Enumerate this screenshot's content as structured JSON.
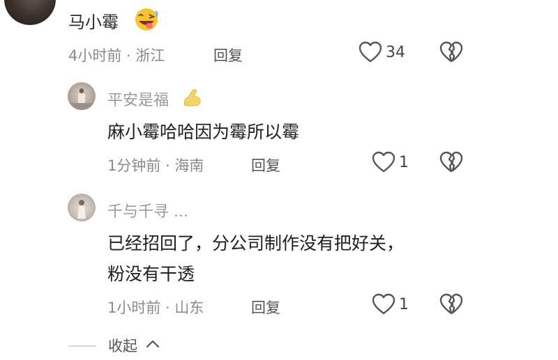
{
  "comment": {
    "author": "马小霉",
    "emoji": "laughing-tongue-emoji",
    "time_location": "4小时前 · 浙江",
    "reply_label": "回复",
    "likes": "34"
  },
  "replies": [
    {
      "author": "平安是福",
      "author_emoji": "flexed-biceps-emoji",
      "text_lines": [
        "麻小霉哈哈因为霉所以霉"
      ],
      "time_location": "1分钟前 · 海南",
      "reply_label": "回复",
      "likes": "1"
    },
    {
      "author": "千与千寻 ...",
      "text_lines": [
        "已经招回了，分公司制作没有把好关，",
        "粉没有干透"
      ],
      "time_location": "1小时前 · 山东",
      "reply_label": "回复",
      "likes": "1"
    }
  ],
  "collapse_label": "收起",
  "colors": {
    "meta_gray": "#8a8a8a",
    "text": "#1f1f1f",
    "icon": "#555555"
  }
}
